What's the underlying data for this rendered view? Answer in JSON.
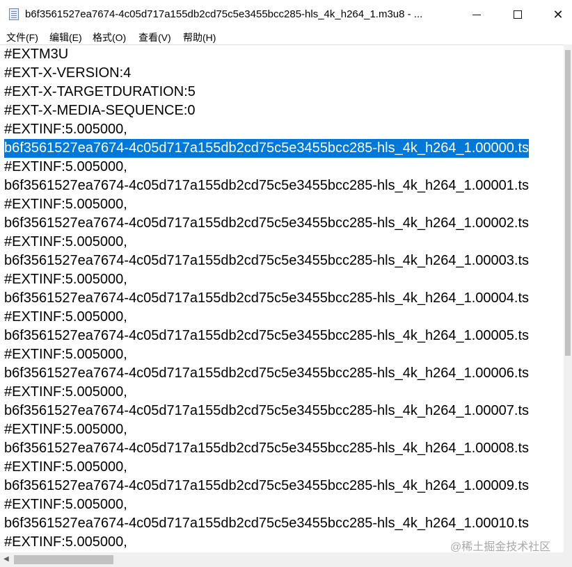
{
  "window": {
    "title": "b6f3561527ea7674-4c05d717a155db2cd75c5e3455bcc285-hls_4k_h264_1.m3u8 - ...",
    "minimize_icon": "minimize-icon",
    "maximize_icon": "maximize-icon",
    "close_icon": "close-icon"
  },
  "menu": [
    "文件(F)",
    "编辑(E)",
    "格式(O)",
    "查看(V)",
    "帮助(H)"
  ],
  "lines": [
    "#EXTM3U",
    "#EXT-X-VERSION:4",
    "#EXT-X-TARGETDURATION:5",
    "#EXT-X-MEDIA-SEQUENCE:0",
    "#EXTINF:5.005000,",
    "b6f3561527ea7674-4c05d717a155db2cd75c5e3455bcc285-hls_4k_h264_1.00000.ts",
    "#EXTINF:5.005000,",
    "b6f3561527ea7674-4c05d717a155db2cd75c5e3455bcc285-hls_4k_h264_1.00001.ts",
    "#EXTINF:5.005000,",
    "b6f3561527ea7674-4c05d717a155db2cd75c5e3455bcc285-hls_4k_h264_1.00002.ts",
    "#EXTINF:5.005000,",
    "b6f3561527ea7674-4c05d717a155db2cd75c5e3455bcc285-hls_4k_h264_1.00003.ts",
    "#EXTINF:5.005000,",
    "b6f3561527ea7674-4c05d717a155db2cd75c5e3455bcc285-hls_4k_h264_1.00004.ts",
    "#EXTINF:5.005000,",
    "b6f3561527ea7674-4c05d717a155db2cd75c5e3455bcc285-hls_4k_h264_1.00005.ts",
    "#EXTINF:5.005000,",
    "b6f3561527ea7674-4c05d717a155db2cd75c5e3455bcc285-hls_4k_h264_1.00006.ts",
    "#EXTINF:5.005000,",
    "b6f3561527ea7674-4c05d717a155db2cd75c5e3455bcc285-hls_4k_h264_1.00007.ts",
    "#EXTINF:5.005000,",
    "b6f3561527ea7674-4c05d717a155db2cd75c5e3455bcc285-hls_4k_h264_1.00008.ts",
    "#EXTINF:5.005000,",
    "b6f3561527ea7674-4c05d717a155db2cd75c5e3455bcc285-hls_4k_h264_1.00009.ts",
    "#EXTINF:5.005000,",
    "b6f3561527ea7674-4c05d717a155db2cd75c5e3455bcc285-hls_4k_h264_1.00010.ts",
    "#EXTINF:5.005000,"
  ],
  "selected_line_index": 5,
  "selection_color": "#0078d7",
  "watermark": "@稀土掘金技术社区"
}
